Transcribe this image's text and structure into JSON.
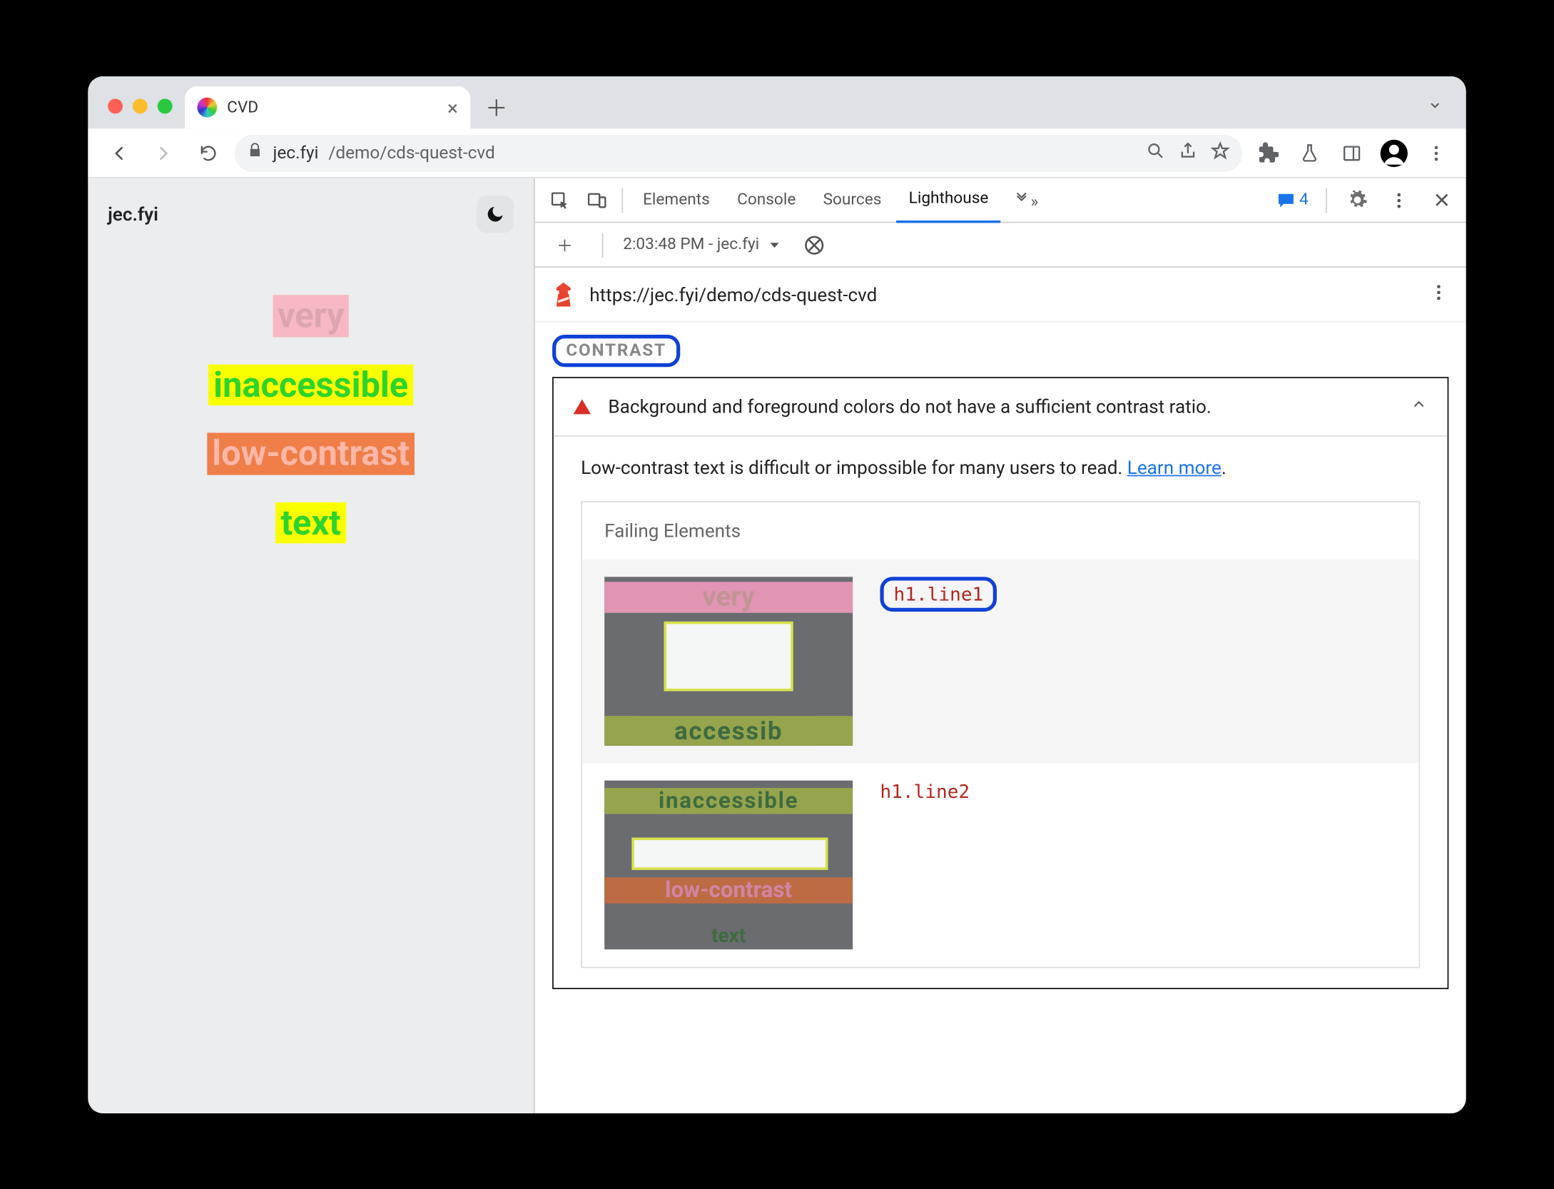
{
  "browser": {
    "tab_title": "CVD",
    "url_host": "jec.fyi",
    "url_path": "/demo/cds-quest-cvd"
  },
  "page": {
    "site_title": "jec.fyi",
    "lines": {
      "l1": "very",
      "l2": "inaccessible",
      "l3": "low-contrast",
      "l4": "text"
    }
  },
  "devtools": {
    "tabs": {
      "elements": "Elements",
      "console": "Console",
      "sources": "Sources",
      "lighthouse": "Lighthouse"
    },
    "issues_count": "4",
    "subbar": {
      "timestamp": "2:03:48 PM - jec.fyi"
    },
    "lighthouse": {
      "url": "https://jec.fyi/demo/cds-quest-cvd",
      "section_label": "CONTRAST",
      "audit_title": "Background and foreground colors do not have a sufficient contrast ratio.",
      "audit_desc_prefix": "Low-contrast text is difficult or impossible for many users to read. ",
      "audit_learn_more": "Learn more",
      "audit_desc_suffix": ".",
      "failing_label": "Failing Elements",
      "items": [
        {
          "selector": "h1.line1"
        },
        {
          "selector": "h1.line2"
        }
      ]
    }
  }
}
